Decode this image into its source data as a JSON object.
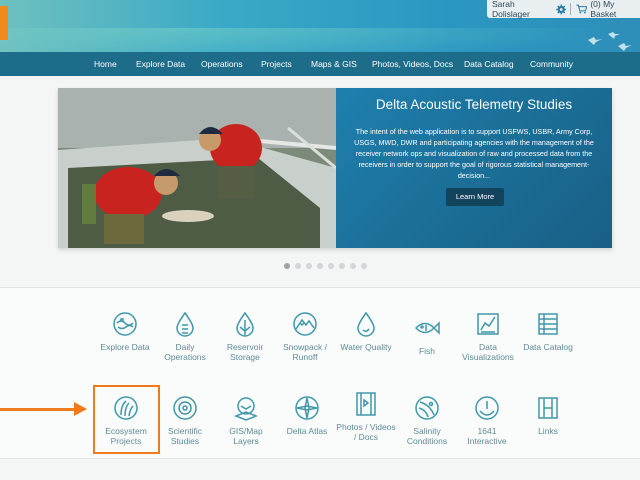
{
  "header": {
    "user_name": "Sarah Dolislager",
    "basket_label": "(0) My Basket"
  },
  "nav": [
    {
      "label": "Home"
    },
    {
      "label": "Explore Data"
    },
    {
      "label": "Operations"
    },
    {
      "label": "Projects"
    },
    {
      "label": "Maps & GIS"
    },
    {
      "label": "Photos, Videos, Docs"
    },
    {
      "label": "Data Catalog"
    },
    {
      "label": "Community"
    }
  ],
  "slide": {
    "title": "Delta Acoustic Telemetry Studies",
    "body": "The intent of the web application is to support USFWS, USBR, Army Corp, USGS, MWD, DWR and participating agencies with the management of the receiver network ops and visualization of raw and processed data from the receivers in order to support the goal of rigorous statistical management-decision...",
    "button": "Learn More",
    "dots_count": 8,
    "active_dot": 1
  },
  "tiles_row1": [
    {
      "icon": "explore-data-icon",
      "label": "Explore Data"
    },
    {
      "icon": "daily-operations-icon",
      "label": "Daily Operations"
    },
    {
      "icon": "reservoir-storage-icon",
      "label": "Reservoir Storage"
    },
    {
      "icon": "snowpack-runoff-icon",
      "label": "Snowpack / Runoff"
    },
    {
      "icon": "water-quality-icon",
      "label": "Water Quality"
    },
    {
      "icon": "fish-icon",
      "label": "Fish"
    },
    {
      "icon": "data-visualizations-icon",
      "label": "Data Visualizations"
    },
    {
      "icon": "data-catalog-icon",
      "label": "Data Catalog"
    }
  ],
  "tiles_row2": [
    {
      "icon": "ecosystem-projects-icon",
      "label": "Ecosystem Projects"
    },
    {
      "icon": "scientific-studies-icon",
      "label": "Scientific Studies"
    },
    {
      "icon": "gis-map-layers-icon",
      "label": "GIS/Map Layers"
    },
    {
      "icon": "delta-atlas-icon",
      "label": "Delta Atlas"
    },
    {
      "icon": "photos-videos-docs-icon",
      "label": "Photos / Videos / Docs"
    },
    {
      "icon": "salinity-conditions-icon",
      "label": "Salinity Conditions"
    },
    {
      "icon": "interactive-1641-icon",
      "label": "1641 Interactive"
    },
    {
      "icon": "links-icon",
      "label": "Links"
    }
  ],
  "colors": {
    "accent": "#f07b1e",
    "nav_bg": "#1d6c8a",
    "icon": "#5e8b97"
  }
}
